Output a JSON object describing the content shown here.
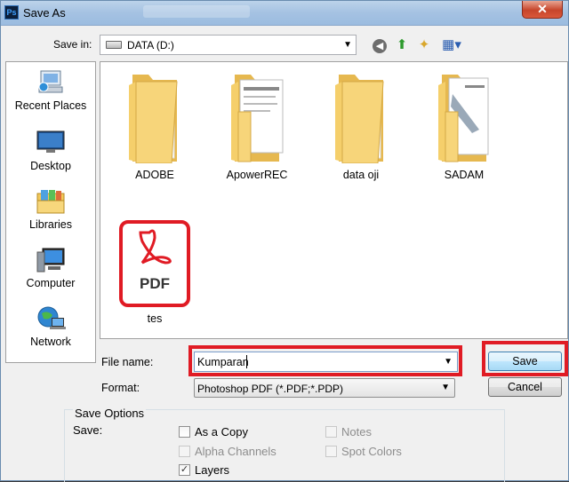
{
  "window": {
    "title": "Save As",
    "app_icon": "Ps",
    "close_glyph": "✕"
  },
  "save_in": {
    "label": "Save in:",
    "value": "DATA (D:)"
  },
  "toolbar": {
    "back_glyph": "◀",
    "up_glyph": "⬆",
    "new_folder_glyph": "✦",
    "views_glyph": "▦▾"
  },
  "places": [
    {
      "label": "Recent Places",
      "icon": "recent-places-icon"
    },
    {
      "label": "Desktop",
      "icon": "desktop-icon"
    },
    {
      "label": "Libraries",
      "icon": "libraries-icon"
    },
    {
      "label": "Computer",
      "icon": "computer-icon"
    },
    {
      "label": "Network",
      "icon": "network-icon"
    }
  ],
  "files": [
    {
      "label": "ADOBE",
      "type": "folder"
    },
    {
      "label": "ApowerREC",
      "type": "folder"
    },
    {
      "label": "data oji",
      "type": "folder"
    },
    {
      "label": "SADAM",
      "type": "folder"
    },
    {
      "label": "tes",
      "type": "pdf",
      "badge": "PDF"
    }
  ],
  "file_name": {
    "label": "File name:",
    "value": "Kumparan"
  },
  "format": {
    "label": "Format:",
    "value": "Photoshop PDF (*.PDF;*.PDP)"
  },
  "buttons": {
    "save": "Save",
    "cancel": "Cancel"
  },
  "save_options": {
    "title": "Save Options",
    "save_label": "Save:",
    "checkboxes": [
      {
        "label": "As a Copy",
        "checked": false,
        "enabled": true
      },
      {
        "label": "Notes",
        "checked": false,
        "enabled": false
      },
      {
        "label": "Alpha Channels",
        "checked": false,
        "enabled": false
      },
      {
        "label": "Spot Colors",
        "checked": false,
        "enabled": false
      },
      {
        "label": "Layers",
        "checked": true,
        "enabled": true
      }
    ]
  },
  "colors": {
    "highlight": "#e01b24",
    "folder": "#f5cf6b",
    "pdf_red": "#e01b24"
  }
}
